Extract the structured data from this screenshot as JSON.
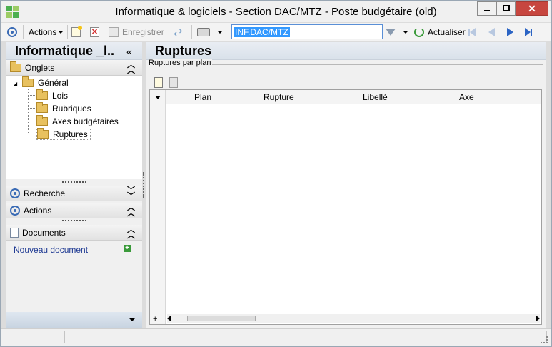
{
  "window": {
    "title": "Informatique & logiciels - Section DAC/MTZ -  Poste budgétaire (old)"
  },
  "toolbar": {
    "actions_label": "Actions",
    "save_label": "Enregistrer",
    "search_value": "INF.DAC/MTZ",
    "refresh_label": "Actualiser"
  },
  "left_panel": {
    "title": "Informatique _l..",
    "onglets_label": "Onglets",
    "tree_root": "Général",
    "tree_items": [
      "Lois",
      "Rubriques",
      "Axes budgétaires",
      "Ruptures"
    ],
    "selected_item": "Ruptures",
    "recherche_label": "Recherche",
    "actions_label": "Actions",
    "documents_label": "Documents",
    "new_document_label": "Nouveau document"
  },
  "main": {
    "title": "Ruptures",
    "group_label": "Ruptures par plan",
    "columns": [
      "Plan",
      "Rupture",
      "Libellé",
      "Axe"
    ],
    "rows": []
  },
  "colors": {
    "accent_blue": "#3a6bb5",
    "selection": "#3399ff",
    "close_button": "#c7463f",
    "header_gradient": "#d9e1ea",
    "folder": "#e8c15f"
  }
}
